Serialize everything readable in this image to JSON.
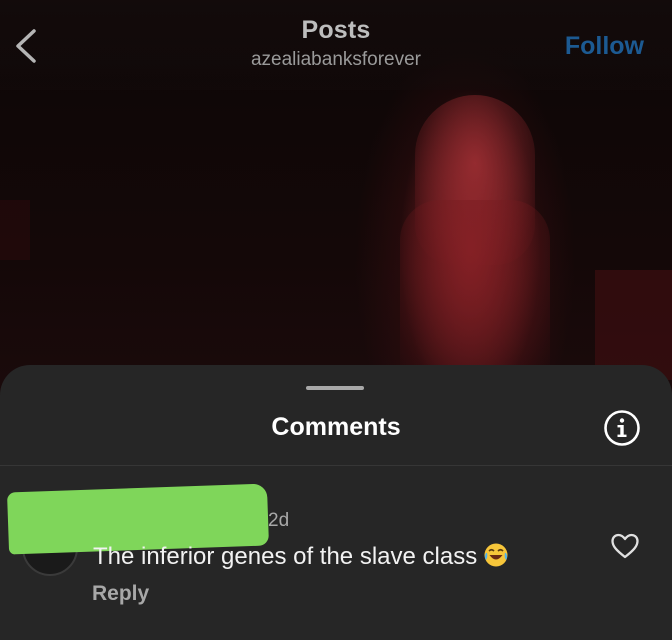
{
  "header": {
    "title": "Posts",
    "username": "azealiabanksforever",
    "follow_label": "Follow"
  },
  "icons": {
    "back": "chevron-left-icon",
    "info": "info-icon",
    "like": "heart-icon",
    "emoji": "face-with-tears-of-joy"
  },
  "comments_sheet": {
    "title": "Comments",
    "items": [
      {
        "time": "2d",
        "text": "The inferior genes of the slave class",
        "reply_label": "Reply"
      }
    ]
  },
  "colors": {
    "sheet_bg": "#262626",
    "follow_blue": "#1c5a92",
    "redaction": "#7fd65a"
  }
}
